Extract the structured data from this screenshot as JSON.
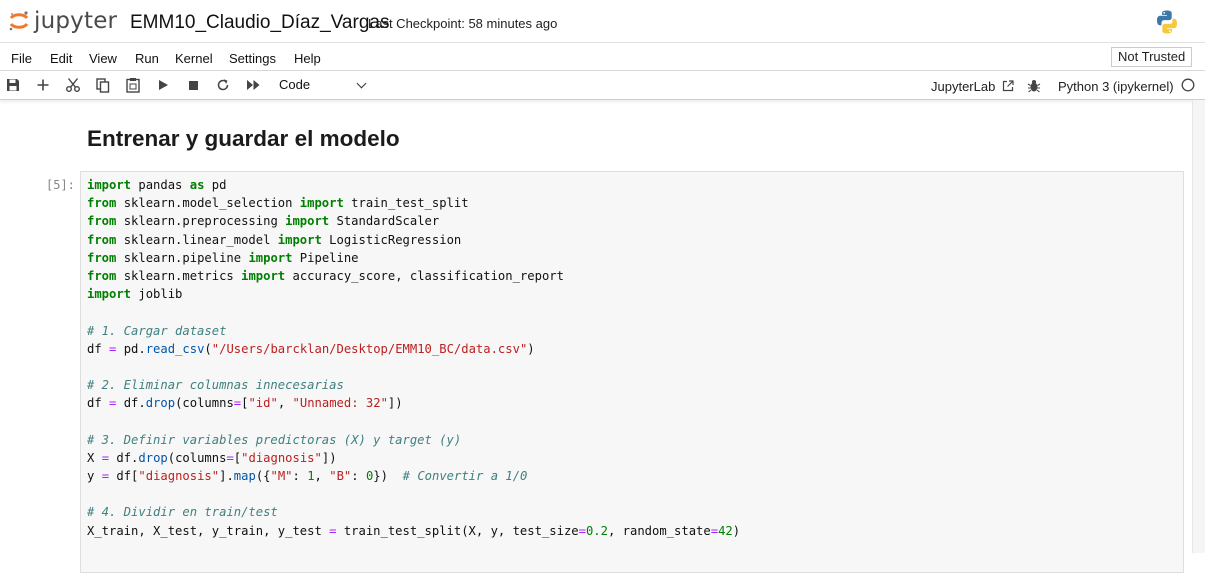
{
  "header": {
    "logo_text": "jupyter",
    "notebook_title": "EMM10_Claudio_Díaz_Vargas",
    "checkpoint": "Last Checkpoint: 58 minutes ago",
    "kernel_logo_icon": "python-icon"
  },
  "menubar": {
    "items": [
      "File",
      "Edit",
      "View",
      "Run",
      "Kernel",
      "Settings",
      "Help"
    ],
    "trusted_label": "Not Trusted"
  },
  "toolbar": {
    "buttons": [
      "save-icon",
      "add-cell-icon",
      "cut-icon",
      "copy-icon",
      "paste-icon",
      "run-icon",
      "stop-icon",
      "restart-icon",
      "run-all-icon"
    ],
    "cell_type": "Code",
    "jupyterlab_label": "JupyterLab",
    "kernel_name": "Python 3 (ipykernel)",
    "kernel_status": "idle"
  },
  "notebook": {
    "heading": "Entrenar y guardar el modelo",
    "cell_prompt": "[5]:",
    "code_lines": [
      "import pandas as pd",
      "from sklearn.model_selection import train_test_split",
      "from sklearn.preprocessing import StandardScaler",
      "from sklearn.linear_model import LogisticRegression",
      "from sklearn.pipeline import Pipeline",
      "from sklearn.metrics import accuracy_score, classification_report",
      "import joblib",
      "",
      "# 1. Cargar dataset",
      "df = pd.read_csv(\"/Users/barcklan/Desktop/EMM10_BC/data.csv\")",
      "",
      "# 2. Eliminar columnas innecesarias",
      "df = df.drop(columns=[\"id\", \"Unnamed: 32\"])",
      "",
      "# 3. Definir variables predictoras (X) y target (y)",
      "X = df.drop(columns=[\"diagnosis\"])",
      "y = df[\"diagnosis\"].map({\"M\": 1, \"B\": 0})  # Convertir a 1/0",
      "",
      "# 4. Dividir en train/test",
      "X_train, X_test, y_train, y_test = train_test_split(X, y, test_size=0.2, random_state=42)"
    ]
  },
  "colors": {
    "keyword": "#008000",
    "string": "#ba2121",
    "comment": "#408080",
    "logo_orange": "#f37726"
  }
}
